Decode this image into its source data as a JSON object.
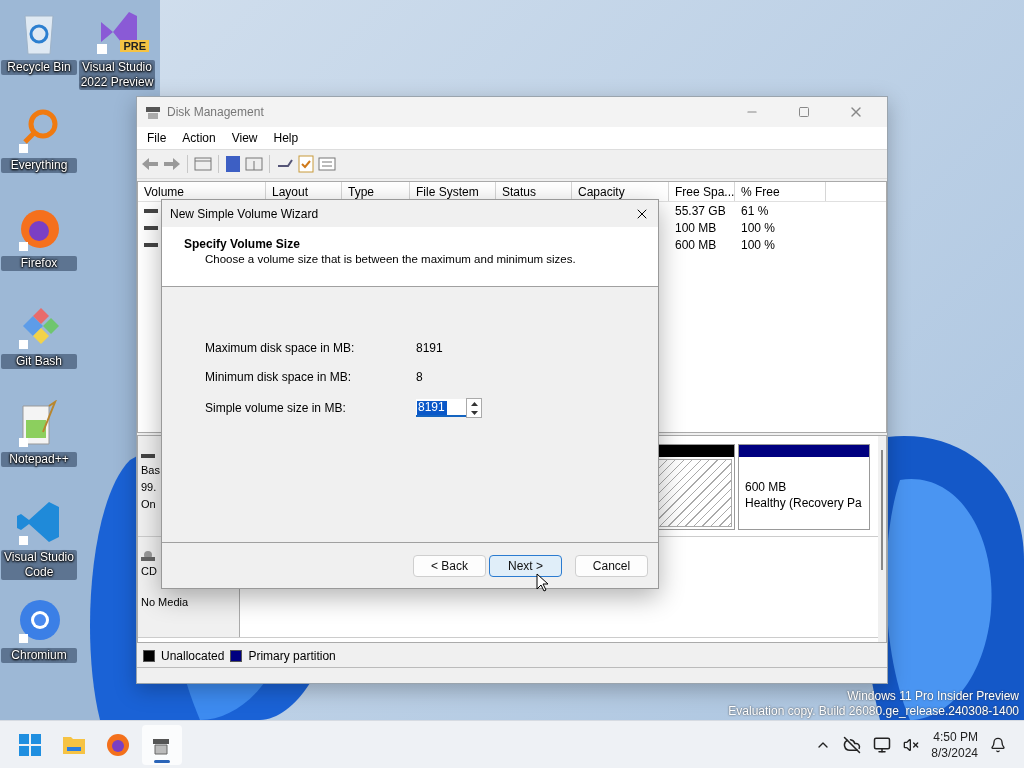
{
  "desktop_icons": [
    {
      "kind": "recycle",
      "label": "Recycle Bin"
    },
    {
      "kind": "vs",
      "label": "Visual Studio 2022 Preview",
      "badge": "PRE"
    },
    {
      "kind": "everything",
      "label": "Everything"
    },
    {
      "kind": "firefox",
      "label": "Firefox"
    },
    {
      "kind": "git",
      "label": "Git Bash"
    },
    {
      "kind": "notepad",
      "label": "Notepad++"
    },
    {
      "kind": "vscode",
      "label": "Visual Studio Code"
    },
    {
      "kind": "chromium",
      "label": "Chromium"
    }
  ],
  "disk_management": {
    "title": "Disk Management",
    "menu": [
      "File",
      "Action",
      "View",
      "Help"
    ],
    "columns": [
      "Volume",
      "Layout",
      "Type",
      "File System",
      "Status",
      "Capacity",
      "Free Spa...",
      "% Free"
    ],
    "rows": [
      {
        "free_space": "55.37 GB",
        "percent_free": "61 %"
      },
      {
        "free_space": "100 MB",
        "percent_free": "100 %"
      },
      {
        "free_space": "600 MB",
        "percent_free": "100 %"
      }
    ],
    "disks": [
      {
        "kind": "disk",
        "lines": [
          "Bas",
          "99.",
          "On"
        ],
        "partitions": [
          {
            "kind": "unallocated"
          },
          {
            "kind": "primary",
            "size": "600 MB",
            "status": "Healthy (Recovery Pa"
          }
        ]
      },
      {
        "kind": "cdrom",
        "lines": [
          "CD",
          "No Media"
        ]
      }
    ],
    "legend": [
      {
        "label": "Unallocated",
        "color": "#000000"
      },
      {
        "label": "Primary partition",
        "color": "#000080"
      }
    ]
  },
  "wizard": {
    "title": "New Simple Volume Wizard",
    "heading": "Specify Volume Size",
    "subtitle": "Choose a volume size that is between the maximum and minimum sizes.",
    "fields": [
      {
        "kind": "text",
        "label": "Maximum disk space in MB:",
        "value": "8191"
      },
      {
        "kind": "text",
        "label": "Minimum disk space in MB:",
        "value": "8"
      },
      {
        "kind": "spinner",
        "label": "Simple volume size in MB:",
        "value": "8191",
        "text_selected": true
      }
    ],
    "buttons": [
      {
        "label": "< Back",
        "default": false
      },
      {
        "label": "Next >",
        "default": true
      },
      {
        "label": "Cancel",
        "default": false
      }
    ]
  },
  "watermark": [
    "Windows 11 Pro Insider Preview",
    "Evaluation copy. Build 26080.ge_release.240308-1400"
  ],
  "taskbar": {
    "apps": [
      {
        "kind": "start",
        "selected": false
      },
      {
        "kind": "files",
        "selected": false
      },
      {
        "kind": "firefox",
        "selected": false
      },
      {
        "kind": "diskmgmt",
        "selected": true
      }
    ],
    "time": "4:50 PM",
    "date": "8/3/2024"
  }
}
